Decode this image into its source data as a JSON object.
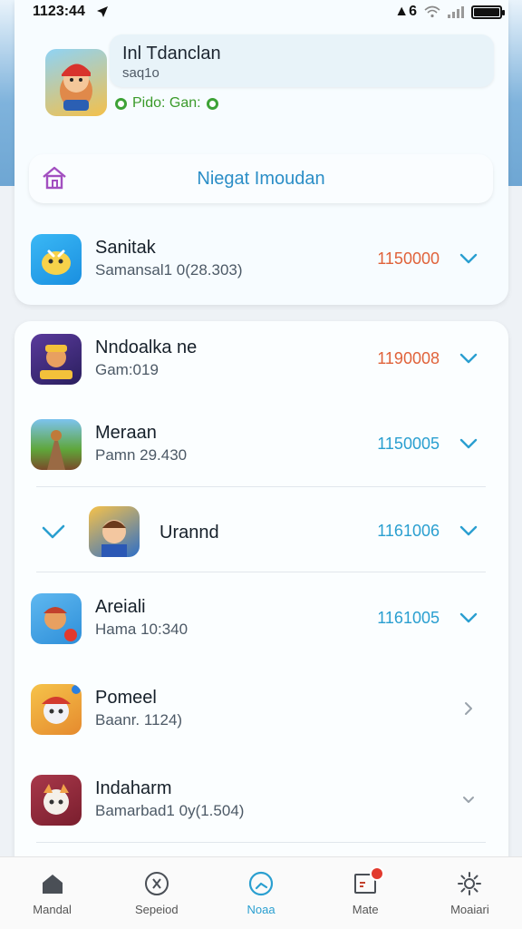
{
  "status_bar": {
    "time": "1123:44",
    "carrier": "6"
  },
  "profile": {
    "name": "Inl Tdanclan",
    "sub": "saq1o",
    "status": "Pido: Gan:"
  },
  "promo": {
    "label": "Niegat Imoudan"
  },
  "apps": [
    {
      "title": "Sanitak",
      "sub": "Samansal1 0(28.303)",
      "value": "1150000",
      "value_color": "#e0623a",
      "chevron": "down"
    },
    {
      "title": "Nndoalka ne",
      "sub": "Gam:019",
      "value": "1190008",
      "value_color": "#e0623a",
      "chevron": "down"
    },
    {
      "title": "Meraan",
      "sub": "Pamn 29.430",
      "value": "1150005",
      "value_color": "#2a9fd0",
      "chevron": "down"
    },
    {
      "title": "Urannd",
      "sub": "",
      "value": "1161006",
      "value_color": "#2a9fd0",
      "chevron": "down"
    },
    {
      "title": "Areiali",
      "sub": "Hama 10:340",
      "value": "1161005",
      "value_color": "#2a9fd0",
      "chevron": "down"
    },
    {
      "title": "Pomeel",
      "sub": "Baanr. 1124)",
      "value": "",
      "value_color": "#2a9fd0",
      "chevron": "right"
    },
    {
      "title": "Indaharm",
      "sub": "Bamarbad1 0y(1.504)",
      "value": "",
      "value_color": "#2a9fd0",
      "chevron": "down-small"
    }
  ],
  "nav": [
    {
      "label": "Mandal",
      "icon": "home-icon"
    },
    {
      "label": "Sepeiod",
      "icon": "compass-icon"
    },
    {
      "label": "Noaa",
      "icon": "clock-icon"
    },
    {
      "label": "Mate",
      "icon": "message-icon"
    },
    {
      "label": "Moaiari",
      "icon": "gear-icon"
    }
  ],
  "colors": {
    "accent": "#2a9fd0",
    "value_warm": "#e0623a",
    "status_green": "#3da236"
  }
}
